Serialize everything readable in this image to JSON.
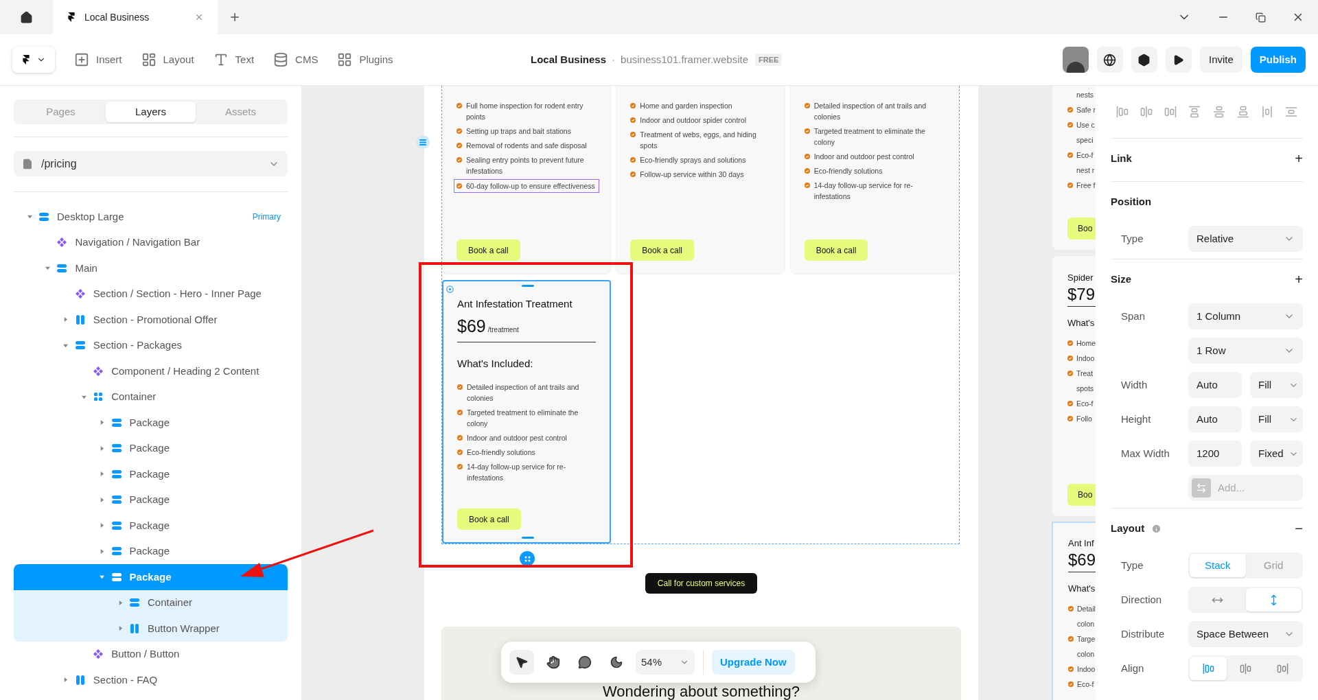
{
  "browser_tabs": [
    {
      "title": "Local Business",
      "selected": true
    }
  ],
  "toolbar": {
    "tools": [
      {
        "label": "Insert",
        "kind": "insert"
      },
      {
        "label": "Layout",
        "kind": "layout"
      },
      {
        "label": "Text",
        "kind": "text"
      },
      {
        "label": "CMS",
        "kind": "cms"
      },
      {
        "label": "Plugins",
        "kind": "plugins"
      }
    ],
    "project": "Local Business",
    "separator": "·",
    "domain": "business101.framer.website",
    "plan": "FREE",
    "invite": "Invite",
    "publish": "Publish"
  },
  "left_panel": {
    "tabs": [
      {
        "label": "Pages",
        "selected": false
      },
      {
        "label": "Layers",
        "selected": true
      },
      {
        "label": "Assets",
        "selected": false
      }
    ],
    "page": "/pricing",
    "layers": [
      {
        "name": "Desktop Large",
        "kind": "stack",
        "badge": "Primary",
        "expanded": true,
        "selected": false,
        "children": [
          {
            "name": "Navigation / Navigation Bar",
            "kind": "component",
            "selected": false
          },
          {
            "name": "Main",
            "kind": "stack",
            "expanded": true,
            "selected": false,
            "children": [
              {
                "name": "Section / Section - Hero - Inner Page",
                "kind": "component",
                "selected": false
              },
              {
                "name": "Section - Promotional Offer",
                "kind": "columns",
                "expanded": false,
                "selected": false
              },
              {
                "name": "Section - Packages",
                "kind": "stack",
                "expanded": true,
                "selected": false,
                "children": [
                  {
                    "name": "Component / Heading 2 Content",
                    "kind": "component",
                    "selected": false
                  },
                  {
                    "name": "Container",
                    "kind": "grid",
                    "expanded": true,
                    "selected": false,
                    "children": [
                      {
                        "name": "Package",
                        "kind": "stack",
                        "expanded": false,
                        "selected": false
                      },
                      {
                        "name": "Package",
                        "kind": "stack",
                        "expanded": false,
                        "selected": false
                      },
                      {
                        "name": "Package",
                        "kind": "stack",
                        "expanded": false,
                        "selected": false
                      },
                      {
                        "name": "Package",
                        "kind": "stack",
                        "expanded": false,
                        "selected": false
                      },
                      {
                        "name": "Package",
                        "kind": "stack",
                        "expanded": false,
                        "selected": false
                      },
                      {
                        "name": "Package",
                        "kind": "stack",
                        "expanded": false,
                        "selected": false
                      },
                      {
                        "name": "Package",
                        "kind": "stack",
                        "expanded": true,
                        "selected": true,
                        "children": [
                          {
                            "name": "Container",
                            "kind": "stack",
                            "expanded": false,
                            "selected": false
                          },
                          {
                            "name": "Button Wrapper",
                            "kind": "columns",
                            "expanded": false,
                            "selected": false
                          }
                        ]
                      }
                    ]
                  },
                  {
                    "name": "Button / Button",
                    "kind": "component",
                    "selected": false
                  }
                ]
              },
              {
                "name": "Section - FAQ",
                "kind": "columns",
                "expanded": false,
                "selected": false
              }
            ]
          }
        ]
      }
    ]
  },
  "canvas": {
    "cards": [
      {
        "features": [
          {
            "text": "Full home inspection for rodent entry points",
            "outlined": false
          },
          {
            "text": "Setting up traps and bait stations",
            "outlined": false
          },
          {
            "text": "Removal of rodents and safe disposal",
            "outlined": false
          },
          {
            "text": "Sealing entry points to prevent future infestations",
            "outlined": false
          },
          {
            "text": "60-day follow-up to ensure effectiveness",
            "outlined": true
          }
        ],
        "button": "Book a call",
        "selected": false
      },
      {
        "features": [
          {
            "text": "Home and garden inspection",
            "outlined": false
          },
          {
            "text": "Indoor and outdoor spider control",
            "outlined": false
          },
          {
            "text": "Treatment of webs, eggs, and hiding spots",
            "outlined": false
          },
          {
            "text": "Eco-friendly sprays and solutions",
            "outlined": false
          },
          {
            "text": "Follow-up service within 30 days",
            "outlined": false
          }
        ],
        "button": "Book a call",
        "selected": false
      },
      {
        "features": [
          {
            "text": "Detailed inspection of ant trails and colonies",
            "outlined": false
          },
          {
            "text": "Targeted treatment to eliminate the colony",
            "outlined": false
          },
          {
            "text": "Indoor and outdoor pest control",
            "outlined": false
          },
          {
            "text": "Eco-friendly solutions",
            "outlined": false
          },
          {
            "text": "14-day follow-up service for re-infestations",
            "outlined": false
          }
        ],
        "button": "Book a call",
        "selected": false
      },
      {
        "title": "Ant Infestation Treatment",
        "price": "$69",
        "unit": "/treatment",
        "heading": "What's Included:",
        "features": [
          {
            "text": "Detailed inspection of ant trails and colonies",
            "outlined": false
          },
          {
            "text": "Targeted treatment to eliminate the colony",
            "outlined": false
          },
          {
            "text": "Indoor and outdoor pest control",
            "outlined": false
          },
          {
            "text": "Eco-friendly solutions",
            "outlined": false
          },
          {
            "text": "14-day follow-up service for re-infestations",
            "outlined": false
          }
        ],
        "button": "Book a call",
        "selected": true
      }
    ],
    "cta": "Call for custom services",
    "faq_heading": "Wondering about something?"
  },
  "side_preview": {
    "cards": [
      {
        "lines": [
          {
            "text": "nests",
            "bullet": false
          },
          {
            "text": "Safe r",
            "bullet": true
          },
          {
            "text": "Use c",
            "bullet": true
          },
          {
            "text": "speci",
            "bullet": false
          },
          {
            "text": "Eco-f",
            "bullet": true
          },
          {
            "text": "nest r",
            "bullet": false
          },
          {
            "text": "Free f",
            "bullet": true
          }
        ],
        "button": "Boo",
        "selected": false
      },
      {
        "title": "Spider",
        "price": "$79",
        "heading": "What's",
        "lines": [
          {
            "text": "Home",
            "bullet": true
          },
          {
            "text": "Indoo",
            "bullet": true
          },
          {
            "text": "Treat",
            "bullet": true
          },
          {
            "text": "spots",
            "bullet": false
          },
          {
            "text": "Eco-f",
            "bullet": true
          },
          {
            "text": "Follo",
            "bullet": true
          }
        ],
        "button": "Boo",
        "selected": false
      },
      {
        "title": "Ant Inf",
        "price": "$69",
        "heading": "What's",
        "lines": [
          {
            "text": "Detail",
            "bullet": true
          },
          {
            "text": "colon",
            "bullet": false
          },
          {
            "text": "Targe",
            "bullet": true
          },
          {
            "text": "colon",
            "bullet": false
          },
          {
            "text": "Indoo",
            "bullet": true
          },
          {
            "text": "Eco-f",
            "bullet": true
          }
        ],
        "selected": true
      }
    ]
  },
  "floating_toolbar": {
    "tools": [
      {
        "selected": true
      },
      {
        "selected": false
      },
      {
        "selected": false
      },
      {
        "selected": false
      }
    ],
    "zoom": "54%",
    "upgrade": "Upgrade Now"
  },
  "inspector": {
    "sections": [
      {
        "title": "Link",
        "action": "+"
      },
      {
        "title": "Position",
        "rows": [
          {
            "kind": "select",
            "label": "Type",
            "value": "Relative"
          }
        ]
      },
      {
        "title": "Size",
        "action": "+",
        "rows": [
          {
            "kind": "select",
            "label": "Span",
            "value": "1 Column"
          },
          {
            "kind": "select",
            "value": "1 Row"
          },
          {
            "kind": "pair",
            "label": "Width",
            "value": "Auto",
            "unit": "Fill"
          },
          {
            "kind": "pair",
            "label": "Height",
            "value": "Auto",
            "unit": "Fill"
          },
          {
            "kind": "pair",
            "label": "Max Width",
            "value": "1200",
            "unit": "Fixed"
          },
          {
            "kind": "add",
            "placeholder": "Add..."
          }
        ]
      },
      {
        "title": "Layout",
        "info": true,
        "action": "−",
        "rows": [
          {
            "kind": "segmented",
            "label": "Type",
            "options": [
              {
                "label": "Stack",
                "selected": true
              },
              {
                "label": "Grid",
                "selected": false
              }
            ]
          },
          {
            "kind": "icons",
            "label": "Direction",
            "options": [
              {
                "selected": false
              },
              {
                "selected": true
              }
            ]
          },
          {
            "kind": "select",
            "label": "Distribute",
            "value": "Space Between"
          },
          {
            "kind": "icons",
            "label": "Align",
            "options": [
              {
                "selected": true
              },
              {
                "selected": false
              },
              {
                "selected": false
              }
            ]
          }
        ]
      }
    ]
  }
}
